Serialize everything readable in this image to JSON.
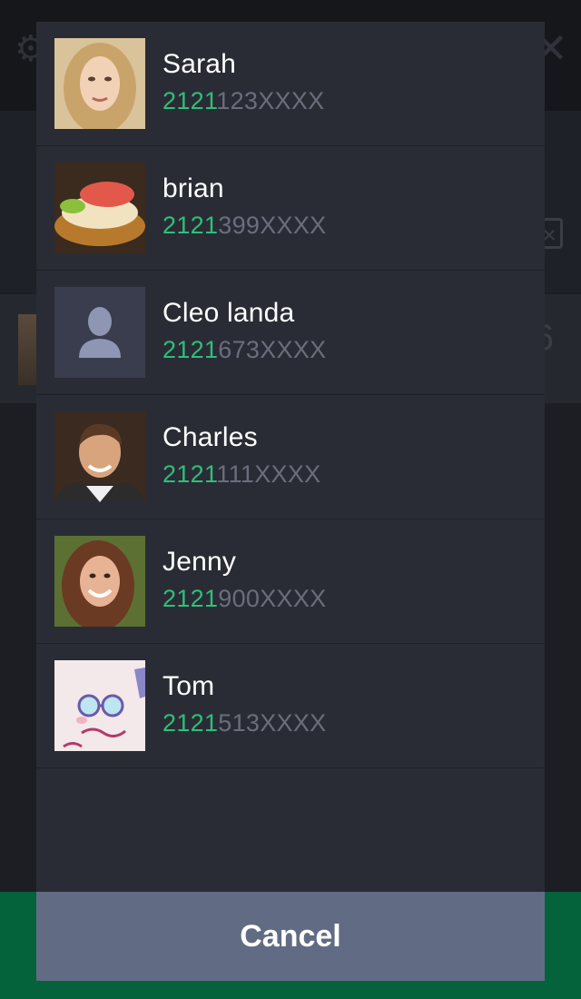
{
  "contacts": [
    {
      "name": "Sarah",
      "phone_prefix": "2121",
      "phone_rest": "123XXXX",
      "avatar": "photo-woman-blonde"
    },
    {
      "name": "brian",
      "phone_prefix": "2121",
      "phone_rest": "399XXXX",
      "avatar": "photo-sushi"
    },
    {
      "name": "Cleo landa",
      "phone_prefix": "2121",
      "phone_rest": "673XXXX",
      "avatar": "default-person-icon"
    },
    {
      "name": "Charles",
      "phone_prefix": "2121",
      "phone_rest": "111XXXX",
      "avatar": "photo-man-smiling"
    },
    {
      "name": "Jenny",
      "phone_prefix": "2121",
      "phone_rest": "900XXXX",
      "avatar": "photo-woman-brunette"
    },
    {
      "name": "Tom",
      "phone_prefix": "2121",
      "phone_rest": "513XXXX",
      "avatar": "cartoon-face"
    }
  ],
  "cancel_label": "Cancel",
  "colors": {
    "modal_bg": "#2a2c35",
    "accent_green": "#2fbf7a",
    "muted_text": "#6a6e7c",
    "cancel_bg": "#626b84",
    "footer_green": "#04633a"
  }
}
